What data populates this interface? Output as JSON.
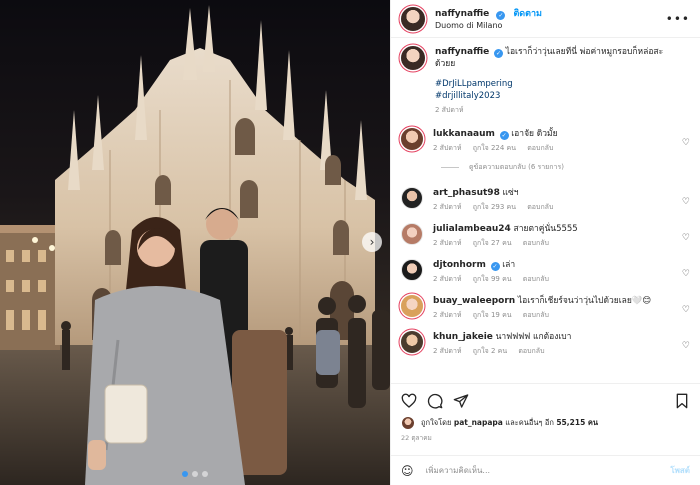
{
  "post": {
    "username": "naffynaffie",
    "follow_label": "ติดตาม",
    "location": "Duomo di Milano",
    "more_label": "•••"
  },
  "caption": {
    "username": "naffynaffie",
    "text": "ไอเราก็ว่าวุ่นเลยทีนี่ พ่อค่าหมูกรอบก็หล่อสะด้วยย",
    "tag1": "#DrJiLLpampering",
    "tag2": "#drjillitaly2023",
    "time": "2 สัปดาห์"
  },
  "comments": [
    {
      "username": "lukkanaaum",
      "verified": true,
      "text": "เอาจัย ดิวมั้ย",
      "time": "2 สัปดาห์",
      "likes": "ถูกใจ 224 คน",
      "reply": "ตอบกลับ"
    },
    {
      "username": "art_phasut98",
      "verified": false,
      "text": "แซ่ฯ",
      "time": "2 สัปดาห์",
      "likes": "ถูกใจ 293 คน",
      "reply": "ตอบกลับ"
    },
    {
      "username": "julialambeau24",
      "verified": false,
      "text": "สายตาคู่นั่น5555",
      "time": "2 สัปดาห์",
      "likes": "ถูกใจ 27 คน",
      "reply": "ตอบกลับ"
    },
    {
      "username": "djtonhorm",
      "verified": true,
      "text": "เล่า",
      "time": "2 สัปดาห์",
      "likes": "ถูกใจ 99 คน",
      "reply": "ตอบกลับ"
    },
    {
      "username": "buay_waleeporn",
      "verified": false,
      "text": "ไอเราก็เชียร์จนว่าวุ่นไปด้วยเลย🤍😊",
      "time": "2 สัปดาห์",
      "likes": "ถูกใจ 19 คน",
      "reply": "ตอบกลับ"
    },
    {
      "username": "khun_jakeie",
      "verified": false,
      "text": "นาฟฟฟฟ แกต้องเบา",
      "time": "2 สัปดาห์",
      "likes": "ถูกใจ 2 คน",
      "reply": "ตอบกลับ"
    }
  ],
  "view_replies": "ดูข้อความตอบกลับ (6 รายการ)",
  "likes_summary": {
    "prefix": "ถูกใจโดย",
    "user": "pat_napapa",
    "suffix": "และคนอื่นๆ อีก",
    "count": "55,215 คน"
  },
  "post_date": "22 ตุลาคม",
  "add_comment": {
    "placeholder": "เพิ่มความคิดเห็น...",
    "post_label": "โพสต์"
  },
  "icons": {
    "like": "heart-icon",
    "comment": "comment-icon",
    "share": "share-icon",
    "save": "bookmark-icon",
    "emoji": "emoji-icon"
  }
}
